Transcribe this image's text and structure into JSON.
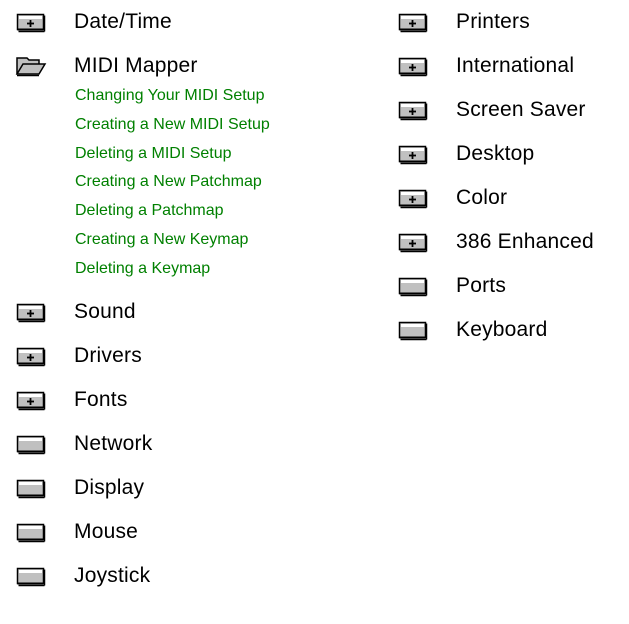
{
  "left_column": {
    "items": [
      {
        "icon": "closed-book-plus-icon",
        "label": "Date/Time"
      },
      {
        "icon": "open-book-icon",
        "label": "MIDI Mapper",
        "expanded": true,
        "subtopics": [
          "Changing Your MIDI Setup",
          "Creating a New MIDI Setup",
          "Deleting a MIDI Setup",
          "Creating a New Patchmap",
          "Deleting a Patchmap",
          "Creating a New Keymap",
          "Deleting a Keymap"
        ]
      },
      {
        "icon": "closed-book-plus-icon",
        "label": "Sound"
      },
      {
        "icon": "closed-book-plus-icon",
        "label": "Drivers"
      },
      {
        "icon": "closed-book-plus-icon",
        "label": "Fonts"
      },
      {
        "icon": "closed-book-icon",
        "label": "Network"
      },
      {
        "icon": "closed-book-icon",
        "label": "Display"
      },
      {
        "icon": "closed-book-icon",
        "label": "Mouse"
      },
      {
        "icon": "closed-book-icon",
        "label": "Joystick"
      }
    ]
  },
  "right_column": {
    "items": [
      {
        "icon": "closed-book-plus-icon",
        "label": "Printers"
      },
      {
        "icon": "closed-book-plus-icon",
        "label": "International"
      },
      {
        "icon": "closed-book-plus-icon",
        "label": "Screen Saver"
      },
      {
        "icon": "closed-book-plus-icon",
        "label": "Desktop"
      },
      {
        "icon": "closed-book-plus-icon",
        "label": "Color"
      },
      {
        "icon": "closed-book-plus-icon",
        "label": "386 Enhanced"
      },
      {
        "icon": "closed-book-icon",
        "label": "Ports"
      },
      {
        "icon": "closed-book-icon",
        "label": "Keyboard"
      }
    ]
  },
  "colors": {
    "subtopic_link": "#008000",
    "text": "#000000",
    "background": "#ffffff"
  }
}
